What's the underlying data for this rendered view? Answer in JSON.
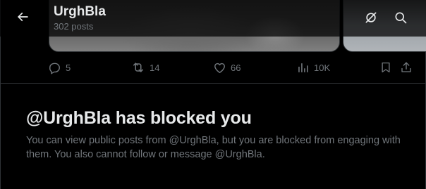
{
  "header": {
    "title": "UrghBla",
    "post_count": "302 posts",
    "back_icon": "arrow-left-icon",
    "grok_icon": "grok-icon",
    "search_icon": "search-icon"
  },
  "post_actions": {
    "replies": "5",
    "reposts": "14",
    "likes": "66",
    "views": "10K"
  },
  "blocked_notice": {
    "title": "@UrghBla has blocked you",
    "body": "You can view public posts from @UrghBla, but you are blocked from engaging with them. You also cannot follow or message @UrghBla."
  },
  "colors": {
    "background": "#000000",
    "text_primary": "#e7e9ea",
    "text_secondary": "#71767b",
    "border": "#2f3336"
  }
}
